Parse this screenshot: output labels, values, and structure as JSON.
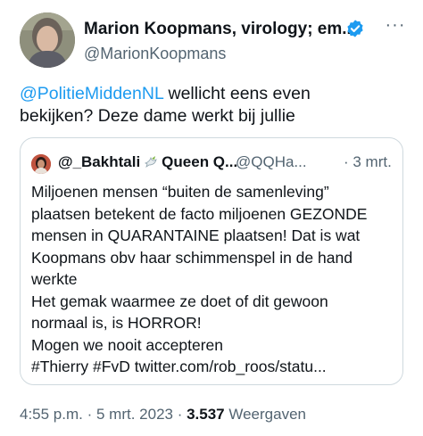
{
  "author": {
    "name": "Marion Koopmans, virology; em...",
    "handle": "@MarionKoopmans",
    "verified": true
  },
  "header": {
    "more_icon": "more-horizontal-icon",
    "more_label": "···"
  },
  "tweet": {
    "mention": "@PolitieMiddenNL",
    "text_after_mention": " wellicht eens even",
    "text_line2": "bekijken? Deze dame werkt bij jullie"
  },
  "quote": {
    "username": "@_Bakhtali",
    "emoji": "dove-emoji",
    "display_name": "Queen Q...",
    "handle": "@QQHa...",
    "date": "· 3 mrt.",
    "lines": [
      "Miljoenen mensen “buiten de samenleving”",
      "plaatsen betekent de facto miljoenen GEZONDE",
      "mensen in QUARANTAINE plaatsen! Dat is wat",
      "Koopmans obv haar schimmenspel in de hand",
      "werkte",
      "Het gemak waarmee ze doet of dit gewoon",
      "normaal is, is HORROR!",
      "Mogen we nooit accepteren",
      "#Thierry #FvD twitter.com/rob_roos/statu..."
    ]
  },
  "meta": {
    "time": "4:55 p.m.",
    "sep1": " · ",
    "date": "5 mrt. 2023",
    "sep2": " · ",
    "views_count": "3.537",
    "views_label": " Weergaven"
  },
  "colors": {
    "link": "#1d9bf0",
    "secondary_text": "#536471",
    "border": "#cfd9de",
    "verified_badge": "#1d9bf0"
  }
}
